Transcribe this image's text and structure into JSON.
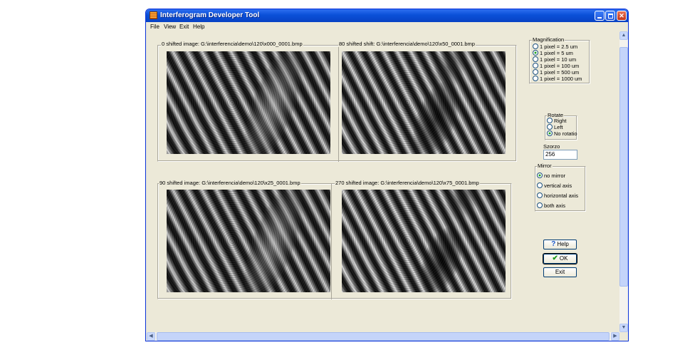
{
  "window": {
    "title": "Interferogram  Developer Tool"
  },
  "menu": [
    "File",
    "View",
    "Exit",
    "Help"
  ],
  "images": [
    {
      "caption": "0 shifted image:  G:\\interferencia\\demo\\120\\x000_0001.bmp"
    },
    {
      "caption": "80 shifted shift:  G:\\interferencia\\demo\\120\\x50_0001.bmp"
    },
    {
      "caption": "90 shifted image:  G:\\interferencia\\demo\\120\\x25_0001.bmp"
    },
    {
      "caption": "270 shifted image:  G:\\interferencia\\demo\\120\\x75_0001.bmp"
    }
  ],
  "magnification": {
    "title": "Magnification",
    "options": [
      "1 pixel = 2.5 um",
      "1 pixel = 5 um",
      "1 pixel = 10 um",
      "1 pixel = 100 um",
      "1 pixel = 500 um",
      "1 pixel = 1000 um"
    ],
    "selected": "1 pixel = 5 um"
  },
  "rotate": {
    "title": "Rotate",
    "options": [
      "Right",
      "Left",
      "No rotation"
    ],
    "selected": "No rotation"
  },
  "szorzo": {
    "label": "Szorzo",
    "value": "256"
  },
  "mirror": {
    "title": "Mirror",
    "options": [
      "no mirror",
      "vertical axis",
      "horizontal axis",
      "both axis"
    ],
    "selected": "no mirror"
  },
  "buttons": {
    "help": "Help",
    "ok": "OK",
    "exit": "Exit"
  },
  "icons": {
    "app": "app-icon",
    "help": "question-mark-icon",
    "ok": "green-check-icon"
  }
}
